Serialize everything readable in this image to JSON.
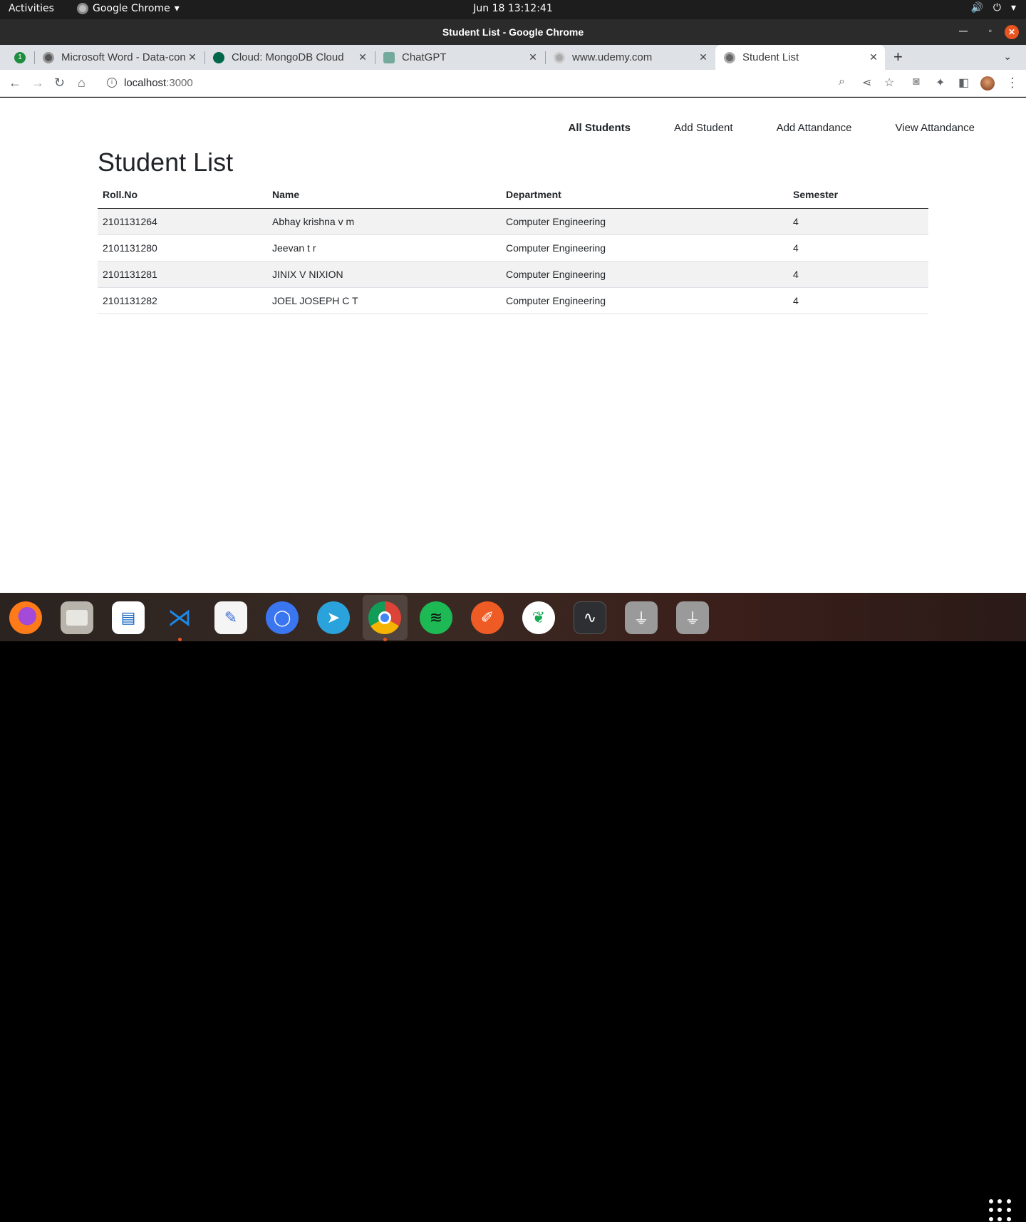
{
  "topbar": {
    "activities": "Activities",
    "app_name": "Google Chrome",
    "clock": "Jun 18  13:12:41"
  },
  "window": {
    "title": "Student List - Google Chrome"
  },
  "tabs": [
    {
      "label": "Microsoft Word - Data-con",
      "favicon": "globe-icon",
      "active": false
    },
    {
      "label": "Cloud: MongoDB Cloud",
      "favicon": "mongodb-leaf-icon",
      "active": false
    },
    {
      "label": "ChatGPT",
      "favicon": "chatgpt-icon",
      "active": false
    },
    {
      "label": "www.udemy.com",
      "favicon": "globe-icon",
      "active": false
    },
    {
      "label": "Student List",
      "favicon": "globe-icon",
      "active": true
    }
  ],
  "toolbar": {
    "url_host": "localhost",
    "url_port": ":3000"
  },
  "nav": {
    "all_students": "All Students",
    "add_student": "Add Student",
    "add_attendance": "Add Attandance",
    "view_attendance": "View Attandance"
  },
  "page": {
    "title": "Student List"
  },
  "table": {
    "headers": [
      "Roll.No",
      "Name",
      "Department",
      "Semester"
    ],
    "rows": [
      [
        "2101131264",
        "Abhay krishna v m",
        "Computer Engineering",
        "4"
      ],
      [
        "2101131280",
        "Jeevan t r",
        "Computer Engineering",
        "4"
      ],
      [
        "2101131281",
        "JINIX V NIXION",
        "Computer Engineering",
        "4"
      ],
      [
        "2101131282",
        "JOEL JOSEPH C T",
        "Computer Engineering",
        "4"
      ]
    ]
  },
  "dock": {
    "apps": [
      "firefox",
      "files",
      "libreoffice-writer",
      "vscode",
      "text-editor",
      "signal",
      "telegram",
      "chrome",
      "spotify",
      "postman",
      "mongodb-compass",
      "system-monitor",
      "usb-drive",
      "usb-drive-2"
    ]
  },
  "colors": {
    "accent": "#e95420",
    "text": "#212529",
    "stripe": "#f2f2f2"
  }
}
